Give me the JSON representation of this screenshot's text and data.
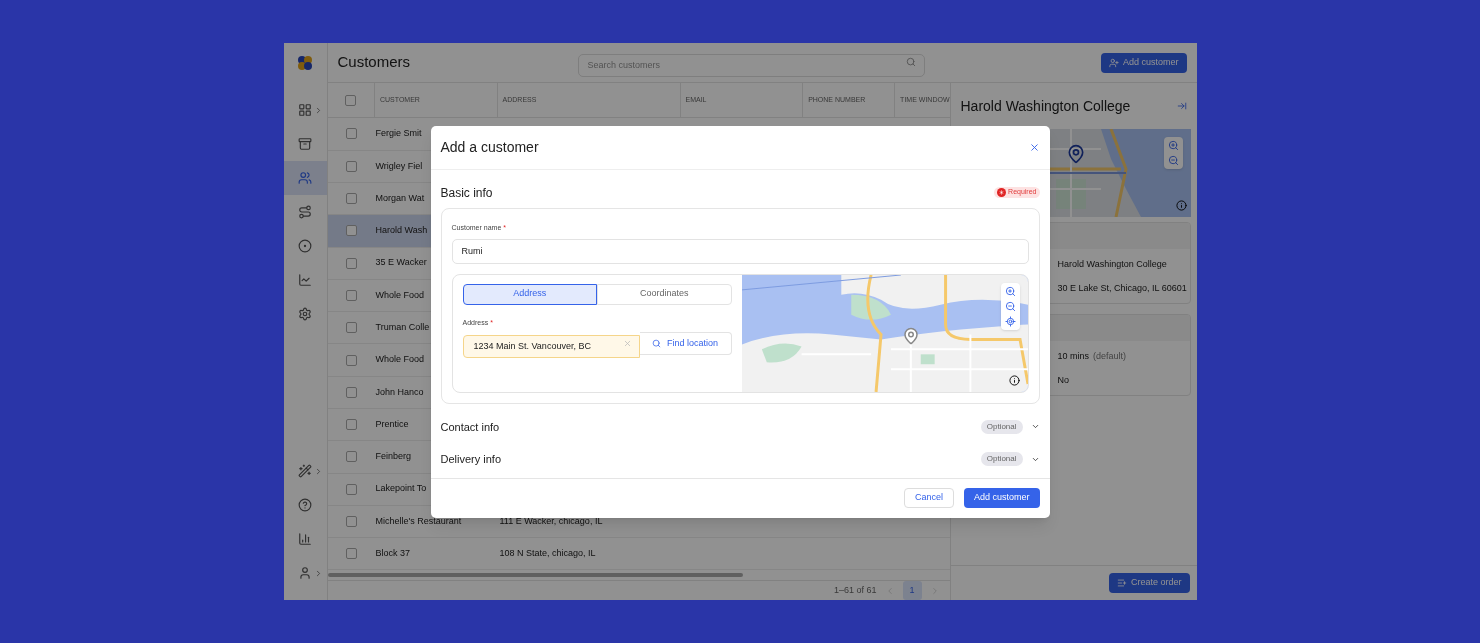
{
  "sidebar": {
    "top_items": [
      {
        "selected": false,
        "submenu": true
      },
      {
        "selected": false,
        "submenu": false
      },
      {
        "selected": true,
        "submenu": false
      },
      {
        "selected": false,
        "submenu": false
      },
      {
        "selected": false,
        "submenu": false
      },
      {
        "selected": false,
        "submenu": false
      },
      {
        "selected": false,
        "submenu": false
      }
    ],
    "bottom_items": [
      {
        "selected": false,
        "submenu": true
      },
      {
        "selected": false,
        "submenu": false
      },
      {
        "selected": false,
        "submenu": false
      },
      {
        "selected": false,
        "submenu": true
      }
    ]
  },
  "header": {
    "title": "Customers",
    "search": {
      "placeholder": "Search customers"
    },
    "add_button": "Add customer"
  },
  "table": {
    "header_checkbox": {
      "checked": false
    },
    "columns": [
      "CUSTOMER",
      "ADDRESS",
      "EMAIL",
      "PHONE NUMBER",
      "TIME WINDOW"
    ],
    "rows": [
      {
        "customer": "Fergie Smit",
        "address": "",
        "checked": false,
        "selected": false
      },
      {
        "customer": "Wrigley Fiel",
        "address": "",
        "checked": false,
        "selected": false
      },
      {
        "customer": "Morgan Wat",
        "address": "",
        "checked": false,
        "selected": false
      },
      {
        "customer": "Harold Wash",
        "address": "",
        "checked": false,
        "selected": true
      },
      {
        "customer": "35 E Wacker",
        "address": "",
        "checked": false,
        "selected": false
      },
      {
        "customer": "Whole Food",
        "address": "",
        "checked": false,
        "selected": false
      },
      {
        "customer": "Truman Colle",
        "address": "",
        "checked": false,
        "selected": false
      },
      {
        "customer": "Whole Food",
        "address": "",
        "checked": false,
        "selected": false
      },
      {
        "customer": "John Hanco",
        "address": "",
        "checked": false,
        "selected": false
      },
      {
        "customer": "Prentice",
        "address": "",
        "checked": false,
        "selected": false
      },
      {
        "customer": "Feinberg",
        "address": "",
        "checked": false,
        "selected": false
      },
      {
        "customer": "Lakepoint To",
        "address": "",
        "checked": false,
        "selected": false
      },
      {
        "customer": "Michelle's Restaurant",
        "address": "111 E Wacker, chicago, IL",
        "checked": false,
        "selected": false
      },
      {
        "customer": "Block 37",
        "address": "108 N State, chicago, IL",
        "checked": false,
        "selected": false
      }
    ],
    "pagination": {
      "range": "1–61 of 61",
      "prev_disabled": true,
      "next_disabled": true,
      "pages": [
        {
          "label": "1",
          "selected": true
        }
      ]
    }
  },
  "detail_panel": {
    "title": "Harold Washington College",
    "cards": [
      {
        "rows": [
          {
            "value": "Harold Washington College"
          },
          {
            "value": "30 E Lake St, Chicago, IL 60601"
          }
        ]
      },
      {
        "rows": [
          {
            "value": "10 mins",
            "note": "(default)"
          },
          {
            "value": "No"
          }
        ]
      }
    ],
    "create_button": "Create order"
  },
  "modal": {
    "title": "Add a customer",
    "basic_info": {
      "title": "Basic info",
      "badge": "Required",
      "name_field": {
        "label": "Customer name",
        "required_mark": "*",
        "value": "Rumi"
      },
      "tabs": [
        {
          "label": "Address",
          "selected": true
        },
        {
          "label": "Coordinates",
          "selected": false
        }
      ],
      "address_field": {
        "label": "Address",
        "required_mark": "*",
        "value": "1234 Main St. Vancouver, BC",
        "highlighted": true
      },
      "find_button": "Find location"
    },
    "sections": [
      {
        "title": "Contact info",
        "badge": "Optional",
        "expanded": false
      },
      {
        "title": "Delivery info",
        "badge": "Optional",
        "expanded": false
      }
    ],
    "buttons": {
      "cancel": "Cancel",
      "submit": "Add customer"
    }
  }
}
